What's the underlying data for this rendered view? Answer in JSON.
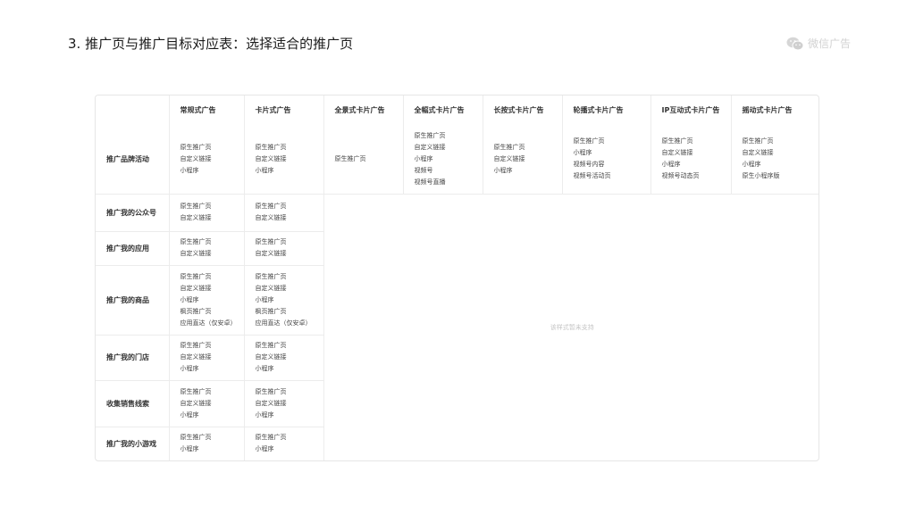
{
  "slide": {
    "title": "3. 推广页与推广目标对应表：选择适合的推广页",
    "logo_text": "微信广告"
  },
  "table": {
    "headers": [
      "常规式广告",
      "卡片式广告",
      "全景式卡片广告",
      "全幅式卡片广告",
      "长按式卡片广告",
      "轮播式卡片广告",
      "IP互动式卡片广告",
      "摇动式卡片广告"
    ],
    "rows": [
      {
        "goal": "推广品牌活动",
        "cells": [
          [
            "原生推广页",
            "自定义链接",
            "小程序"
          ],
          [
            "原生推广页",
            "自定义链接",
            "小程序"
          ],
          [
            "原生推广页"
          ],
          [
            "原生推广页",
            "自定义链接",
            "小程序",
            "视频号",
            "视频号直播"
          ],
          [
            "原生推广页",
            "自定义链接",
            "小程序"
          ],
          [
            "原生推广页",
            "小程序",
            "视频号内容",
            "视频号活动页"
          ],
          [
            "原生推广页",
            "自定义链接",
            "小程序",
            "视频号动态页"
          ],
          [
            "原生推广页",
            "自定义链接",
            "小程序",
            "原生小程序版"
          ]
        ]
      },
      {
        "goal": "推广我的公众号",
        "cells": [
          [
            "原生推广页",
            "自定义链接"
          ],
          [
            "原生推广页",
            "自定义链接"
          ]
        ]
      },
      {
        "goal": "推广我的应用",
        "cells": [
          [
            "原生推广页",
            "自定义链接"
          ],
          [
            "原生推广页",
            "自定义链接"
          ]
        ]
      },
      {
        "goal": "推广我的商品",
        "cells": [
          [
            "原生推广页",
            "自定义链接",
            "小程序",
            "枫页推广页",
            "应用直达（仅安卓）"
          ],
          [
            "原生推广页",
            "自定义链接",
            "小程序",
            "枫页推广页",
            "应用直达（仅安卓）"
          ]
        ]
      },
      {
        "goal": "推广我的门店",
        "cells": [
          [
            "原生推广页",
            "自定义链接",
            "小程序"
          ],
          [
            "原生推广页",
            "自定义链接",
            "小程序"
          ]
        ]
      },
      {
        "goal": "收集销售线索",
        "cells": [
          [
            "原生推广页",
            "自定义链接",
            "小程序"
          ],
          [
            "原生推广页",
            "自定义链接",
            "小程序"
          ]
        ]
      },
      {
        "goal": "推广我的小游戏",
        "cells": [
          [
            "原生推广页",
            "小程序"
          ],
          [
            "原生推广页",
            "小程序"
          ]
        ]
      }
    ],
    "unsupported_note": "该样式暂未支持"
  }
}
